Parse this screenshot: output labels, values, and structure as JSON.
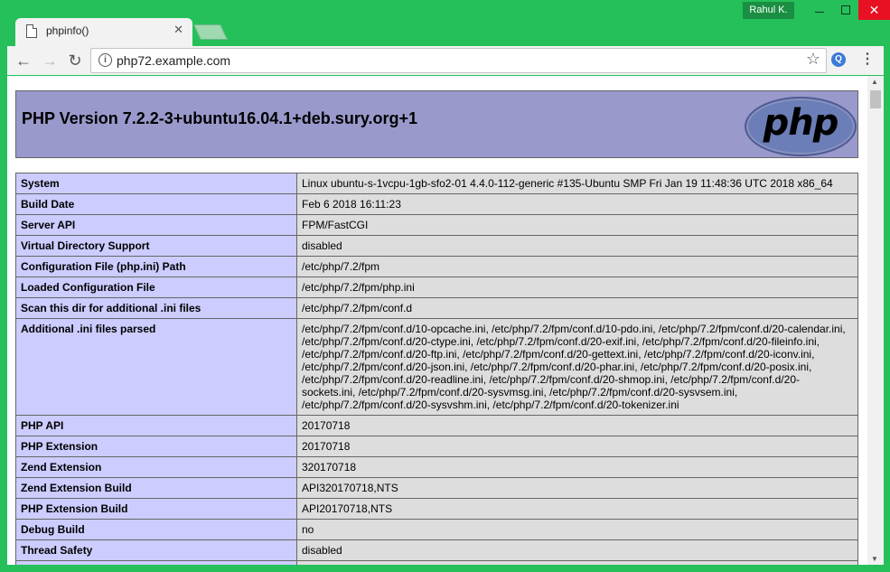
{
  "window": {
    "user": "Rahul K.",
    "minimize_glyph": "",
    "maximize_glyph": "",
    "close_glyph": "✕"
  },
  "tab": {
    "title": "phpinfo()",
    "close_glyph": "✕"
  },
  "toolbar": {
    "back_glyph": "←",
    "forward_glyph": "→",
    "reload_glyph": "↻",
    "url": "php72.example.com",
    "info_glyph": "i",
    "star_glyph": "☆",
    "extension_glyph": "Q",
    "menu_glyph": "⋮"
  },
  "page": {
    "php_version": "PHP Version 7.2.2-3+ubuntu16.04.1+deb.sury.org+1",
    "logo_text": "php",
    "rows": [
      {
        "key": "System",
        "value": "Linux ubuntu-s-1vcpu-1gb-sfo2-01 4.4.0-112-generic #135-Ubuntu SMP Fri Jan 19 11:48:36 UTC 2018 x86_64"
      },
      {
        "key": "Build Date",
        "value": "Feb 6 2018 16:11:23"
      },
      {
        "key": "Server API",
        "value": "FPM/FastCGI"
      },
      {
        "key": "Virtual Directory Support",
        "value": "disabled"
      },
      {
        "key": "Configuration File (php.ini) Path",
        "value": "/etc/php/7.2/fpm"
      },
      {
        "key": "Loaded Configuration File",
        "value": "/etc/php/7.2/fpm/php.ini"
      },
      {
        "key": "Scan this dir for additional .ini files",
        "value": "/etc/php/7.2/fpm/conf.d"
      },
      {
        "key": "Additional .ini files parsed",
        "value": "/etc/php/7.2/fpm/conf.d/10-opcache.ini, /etc/php/7.2/fpm/conf.d/10-pdo.ini, /etc/php/7.2/fpm/conf.d/20-calendar.ini, /etc/php/7.2/fpm/conf.d/20-ctype.ini, /etc/php/7.2/fpm/conf.d/20-exif.ini, /etc/php/7.2/fpm/conf.d/20-fileinfo.ini, /etc/php/7.2/fpm/conf.d/20-ftp.ini, /etc/php/7.2/fpm/conf.d/20-gettext.ini, /etc/php/7.2/fpm/conf.d/20-iconv.ini, /etc/php/7.2/fpm/conf.d/20-json.ini, /etc/php/7.2/fpm/conf.d/20-phar.ini, /etc/php/7.2/fpm/conf.d/20-posix.ini, /etc/php/7.2/fpm/conf.d/20-readline.ini, /etc/php/7.2/fpm/conf.d/20-shmop.ini, /etc/php/7.2/fpm/conf.d/20-sockets.ini, /etc/php/7.2/fpm/conf.d/20-sysvmsg.ini, /etc/php/7.2/fpm/conf.d/20-sysvsem.ini, /etc/php/7.2/fpm/conf.d/20-sysvshm.ini, /etc/php/7.2/fpm/conf.d/20-tokenizer.ini"
      },
      {
        "key": "PHP API",
        "value": "20170718"
      },
      {
        "key": "PHP Extension",
        "value": "20170718"
      },
      {
        "key": "Zend Extension",
        "value": "320170718"
      },
      {
        "key": "Zend Extension Build",
        "value": "API320170718,NTS"
      },
      {
        "key": "PHP Extension Build",
        "value": "API20170718,NTS"
      },
      {
        "key": "Debug Build",
        "value": "no"
      },
      {
        "key": "Thread Safety",
        "value": "disabled"
      },
      {
        "key": "",
        "value": ""
      }
    ]
  },
  "colors": {
    "window_frame": "#25c05a",
    "header_bg": "#9999cc",
    "key_cell_bg": "#ccccff",
    "value_cell_bg": "#dddddd",
    "close_button": "#e81123"
  },
  "scrollbar": {
    "up_glyph": "▲",
    "down_glyph": "▼"
  }
}
